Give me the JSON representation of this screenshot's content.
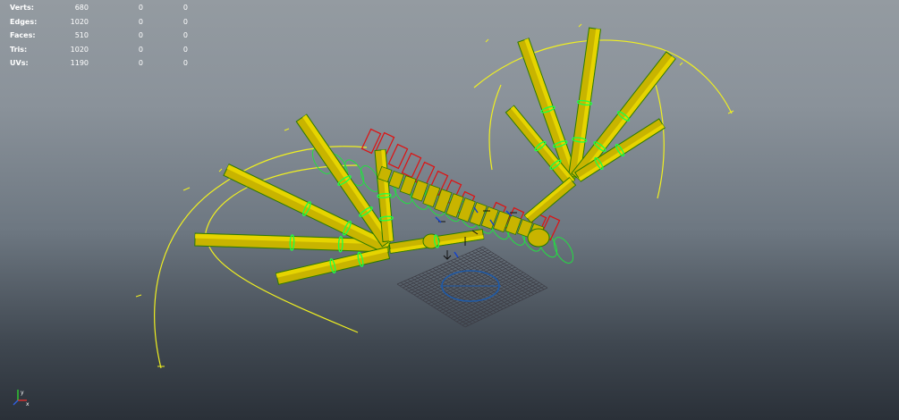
{
  "hud": {
    "rows": [
      {
        "label": "Verts:",
        "v1": "680",
        "v2": "0",
        "v3": "0"
      },
      {
        "label": "Edges:",
        "v1": "1020",
        "v2": "0",
        "v3": "0"
      },
      {
        "label": "Faces:",
        "v1": "510",
        "v2": "0",
        "v3": "0"
      },
      {
        "label": "Tris:",
        "v1": "1020",
        "v2": "0",
        "v3": "0"
      },
      {
        "label": "UVs:",
        "v1": "1190",
        "v2": "0",
        "v3": "0"
      }
    ]
  },
  "axis": {
    "x_label": "x",
    "y_label": "y"
  },
  "colors": {
    "bone": "#c8b400",
    "bone_highlight": "#e6d400",
    "bone_outline": "#2a7a00",
    "joint": "#22ff44",
    "nurbs_curve": "#f0f020",
    "ik_control": "#e01010",
    "fk_control": "#22e040",
    "grid": "#3c3c44",
    "locator": "#1e5aa8",
    "hud_text": "#ffffff"
  },
  "icons": [
    "axis-indicator-icon"
  ]
}
